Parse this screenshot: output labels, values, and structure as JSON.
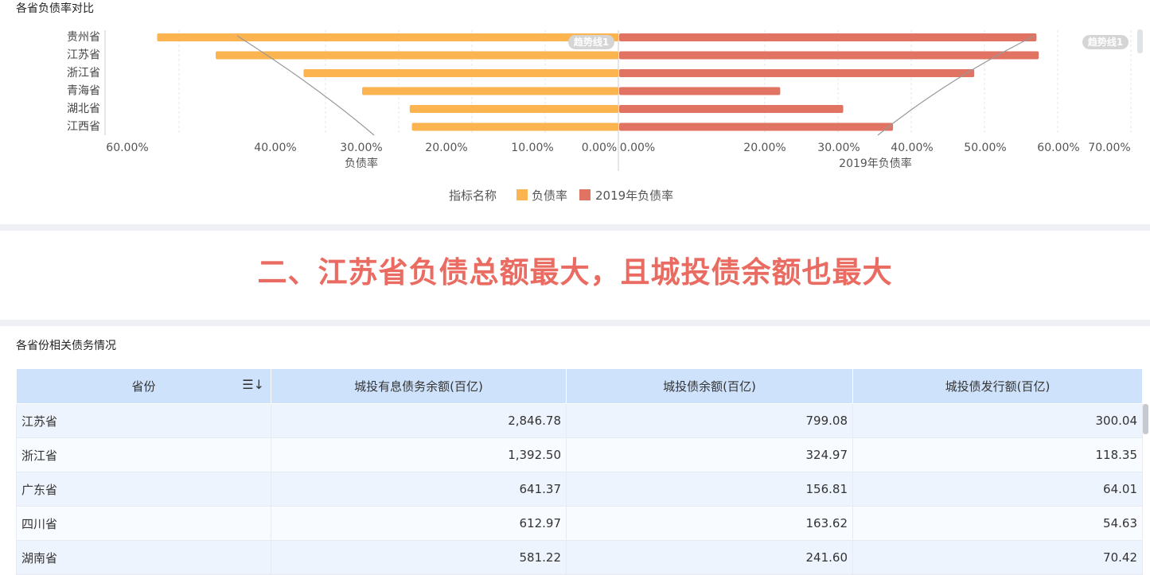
{
  "chart_title": "各省负债率对比",
  "chart_data": {
    "type": "bar",
    "categories": [
      "贵州省",
      "江苏省",
      "浙江省",
      "青海省",
      "湖北省",
      "江西省"
    ],
    "series": [
      {
        "name": "负债率",
        "values": [
          63.0,
          55.0,
          43.0,
          35.0,
          28.5,
          28.2
        ],
        "color": "#fbb44f"
      },
      {
        "name": "2019年负债率",
        "values": [
          57.0,
          57.3,
          48.5,
          22.0,
          30.6,
          37.4
        ],
        "color": "#e07362"
      }
    ],
    "left_axis": {
      "label": "负债率",
      "ticks": [
        "60.00%",
        "40.00%",
        "30.00%",
        "20.00%",
        "10.00%",
        "0.00%"
      ]
    },
    "right_axis": {
      "label": "2019年负债率",
      "ticks": [
        "0.00%",
        "20.00%",
        "30.00%",
        "40.00%",
        "50.00%",
        "60.00%",
        "70.00%"
      ]
    },
    "trend_label_left": "趋势线1",
    "trend_label_right": "趋势线1",
    "legend_title": "指标名称",
    "legend_position": "bottom-center"
  },
  "headline": "二、江苏省负债总额最大，且城投债余额也最大",
  "table": {
    "title": "各省份相关债务情况",
    "columns": [
      "省份",
      "城投有息债务余额(百亿)",
      "城投债余额(百亿)",
      "城投债发行额(百亿)"
    ],
    "rows": [
      [
        "江苏省",
        "2,846.78",
        "799.08",
        "300.04"
      ],
      [
        "浙江省",
        "1,392.50",
        "324.97",
        "118.35"
      ],
      [
        "广东省",
        "641.37",
        "156.81",
        "64.01"
      ],
      [
        "四川省",
        "612.97",
        "163.62",
        "54.63"
      ],
      [
        "湖南省",
        "581.22",
        "241.60",
        "70.42"
      ]
    ]
  }
}
